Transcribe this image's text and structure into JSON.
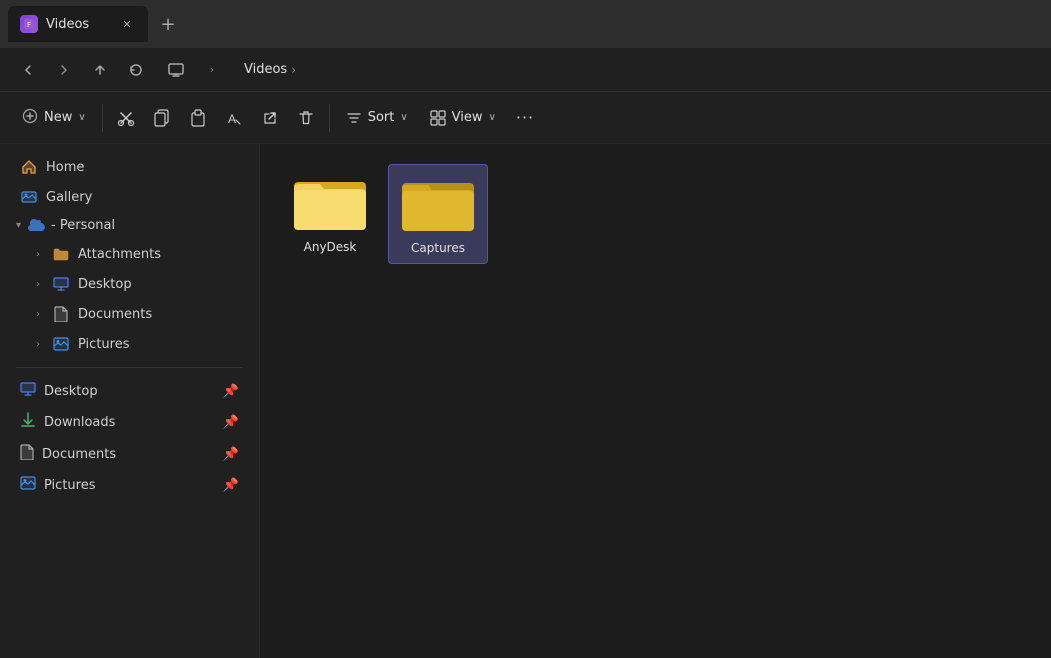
{
  "titleBar": {
    "tab": {
      "label": "Videos",
      "iconText": "F"
    },
    "addTabLabel": "+"
  },
  "navBar": {
    "backLabel": "‹",
    "forwardLabel": "›",
    "upLabel": "↑",
    "refreshLabel": "↻",
    "monitorLabel": "⊡",
    "breadcrumb": {
      "separator": ">",
      "segments": [
        "Videos",
        ">"
      ]
    }
  },
  "toolbar": {
    "newLabel": "New",
    "newArrow": "∨",
    "cutIcon": "✂",
    "copyIcon": "⧉",
    "pasteIcon": "📋",
    "renameIcon": "A",
    "shareIcon": "↗",
    "deleteIcon": "🗑",
    "sortLabel": "Sort",
    "sortArrow": "∨",
    "viewLabel": "View",
    "viewArrow": "∨",
    "moreLabel": "···"
  },
  "sidebar": {
    "topItems": [
      {
        "id": "home",
        "label": "Home",
        "icon": "🏠"
      },
      {
        "id": "gallery",
        "label": "Gallery",
        "icon": "🌄"
      }
    ],
    "cloudSection": {
      "collapseArrow": "▾",
      "cloudIcon": "☁",
      "label": " - Personal"
    },
    "cloudItems": [
      {
        "id": "attachments",
        "label": "Attachments",
        "icon": "📁",
        "expandable": true
      },
      {
        "id": "desktop",
        "label": "Desktop",
        "icon": "🖥",
        "expandable": true
      },
      {
        "id": "documents",
        "label": "Documents",
        "icon": "📄",
        "expandable": true
      },
      {
        "id": "pictures",
        "label": "Pictures",
        "icon": "🌄",
        "expandable": true
      }
    ],
    "pinnedItems": [
      {
        "id": "desktop-pin",
        "label": "Desktop",
        "icon": "🖥",
        "pinned": true
      },
      {
        "id": "downloads-pin",
        "label": "Downloads",
        "icon": "⬇",
        "pinned": true
      },
      {
        "id": "documents-pin",
        "label": "Documents",
        "icon": "📄",
        "pinned": true
      },
      {
        "id": "pictures-pin",
        "label": "Pictures",
        "icon": "🌄",
        "pinned": true
      }
    ]
  },
  "fileArea": {
    "folders": [
      {
        "id": "anydesk",
        "name": "AnyDesk",
        "selected": false
      },
      {
        "id": "captures",
        "name": "Captures",
        "selected": true
      }
    ]
  },
  "colors": {
    "accent": "#5555aa",
    "selectedBg": "#3a3a5a",
    "folderYellow": "#f5d060",
    "folderDarkYellow": "#d4a820"
  }
}
